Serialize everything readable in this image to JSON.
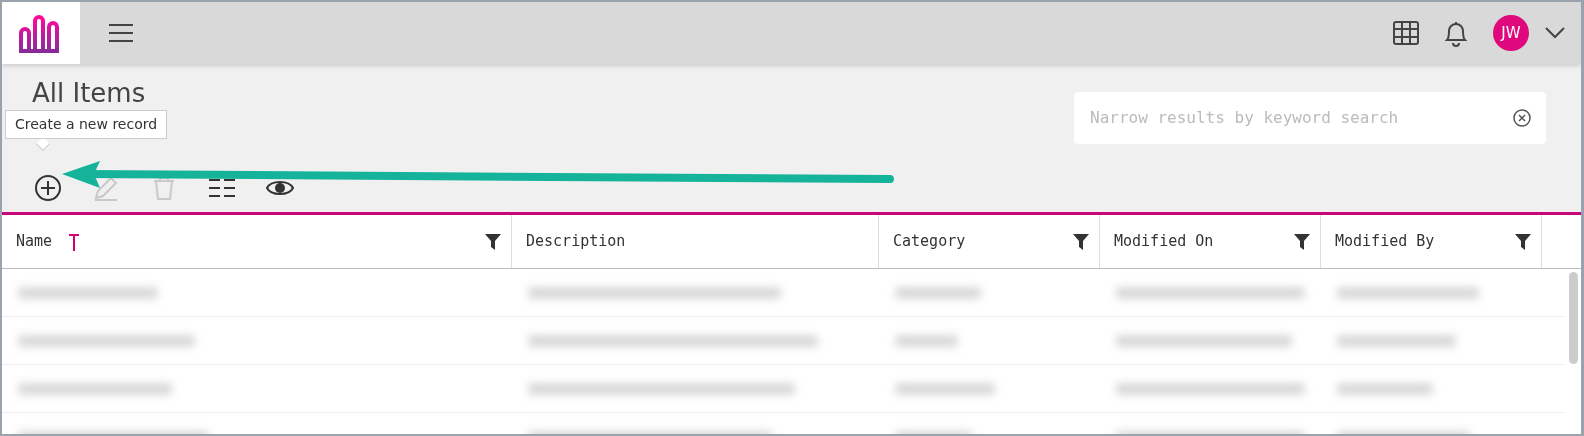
{
  "header": {
    "avatar": "JW"
  },
  "page": {
    "title": "All Items"
  },
  "tooltip": {
    "text": "Create a new record"
  },
  "search": {
    "placeholder": "Narrow results by keyword search"
  },
  "toolbar": [
    {
      "kind": "add",
      "disabled": false
    },
    {
      "kind": "edit",
      "disabled": true
    },
    {
      "kind": "delete",
      "disabled": true
    },
    {
      "kind": "columns",
      "disabled": false
    },
    {
      "kind": "view",
      "disabled": false
    }
  ],
  "table": {
    "columns": [
      {
        "label": "Name",
        "sorted": true,
        "filter": true
      },
      {
        "label": "Description",
        "sorted": false,
        "filter": false
      },
      {
        "label": "Category",
        "sorted": false,
        "filter": true
      },
      {
        "label": "Modified On",
        "sorted": false,
        "filter": true
      },
      {
        "label": "Modified By",
        "sorted": false,
        "filter": true
      }
    ],
    "rows": [
      {
        "redacted": true
      },
      {
        "redacted": true
      },
      {
        "redacted": true
      },
      {
        "redacted": true
      }
    ]
  }
}
